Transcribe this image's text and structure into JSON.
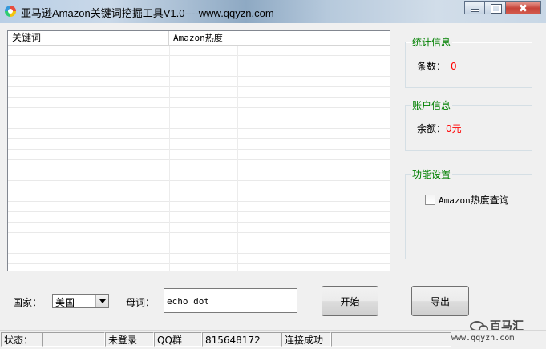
{
  "window": {
    "title": "亚马逊Amazon关键词挖掘工具V1.0----www.qqyzn.com"
  },
  "listview": {
    "columns": [
      "关键词",
      "Amazon热度"
    ]
  },
  "stats": {
    "title": "统计信息",
    "count_label": "条数：",
    "count_value": "0"
  },
  "account": {
    "title": "账户信息",
    "balance_label": "余额：",
    "balance_value": "0元"
  },
  "settings": {
    "title": "功能设置",
    "checkbox_label_latin": "Amazon",
    "checkbox_label_cjk": "热度查询",
    "checkbox_checked": false
  },
  "form": {
    "country_label": "国家：",
    "country_value": "美国",
    "seed_label": "母词：",
    "seed_value": "echo dot",
    "start_button": "开始",
    "export_button": "导出"
  },
  "statusbar": {
    "status_label": "状态：",
    "status_value": "",
    "login_state": "未登录",
    "qq_group_label": "QQ群",
    "qq_group_number": "815648172",
    "connection": "连接成功",
    "extra": ""
  },
  "watermark": {
    "text": "百马汇",
    "url": "www.qqyzn.com"
  }
}
